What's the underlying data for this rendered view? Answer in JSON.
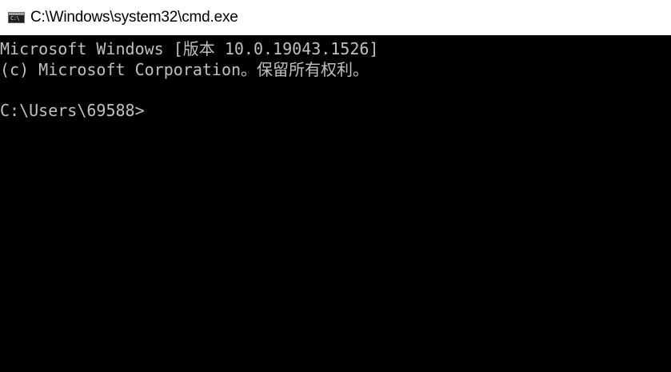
{
  "window": {
    "title": "C:\\Windows\\system32\\cmd.exe",
    "icon": "cmd-icon",
    "icon_glyph": "C:\\"
  },
  "console": {
    "lines": [
      "Microsoft Windows [版本 10.0.19043.1526]",
      "(c) Microsoft Corporation。保留所有权利。",
      "C:\\Users\\69588>"
    ],
    "background": "#000000",
    "foreground": "#c0c0c0"
  }
}
